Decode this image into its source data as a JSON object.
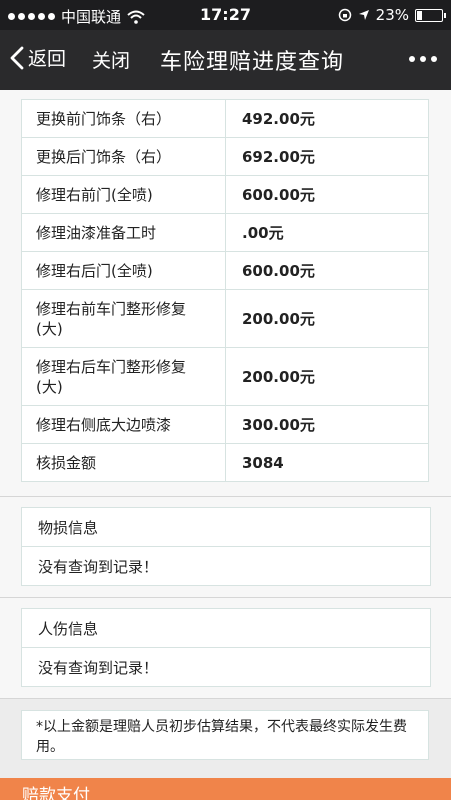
{
  "statusbar": {
    "carrier": "中国联通",
    "time": "17:27",
    "battery_text": "23%",
    "battery_level": 0.23
  },
  "navbar": {
    "back_label": "返回",
    "close_label": "关闭",
    "title": "车险理赔进度查询"
  },
  "cost_items": [
    {
      "name": "更换前门饰条（右）",
      "value": "492.00元"
    },
    {
      "name": "更换后门饰条（右）",
      "value": "692.00元"
    },
    {
      "name": "修理右前门(全喷)",
      "value": "600.00元"
    },
    {
      "name": "修理油漆准备工时",
      "value": ".00元"
    },
    {
      "name": "修理右后门(全喷)",
      "value": "600.00元"
    },
    {
      "name": "修理右前车门整形修复(大)",
      "value": "200.00元"
    },
    {
      "name": "修理右后车门整形修复(大)",
      "value": "200.00元"
    },
    {
      "name": "修理右侧底大边喷漆",
      "value": "300.00元"
    },
    {
      "name": "核损金额",
      "value": "3084"
    }
  ],
  "property_loss": {
    "title": "物损信息",
    "empty": "没有查询到记录！"
  },
  "injury": {
    "title": "人伤信息",
    "empty": "没有查询到记录！"
  },
  "disclaimer": "*以上金额是理赔人员初步估算结果，不代表最终实际发生费用。",
  "bottom_section": {
    "title": "赔款支付"
  }
}
